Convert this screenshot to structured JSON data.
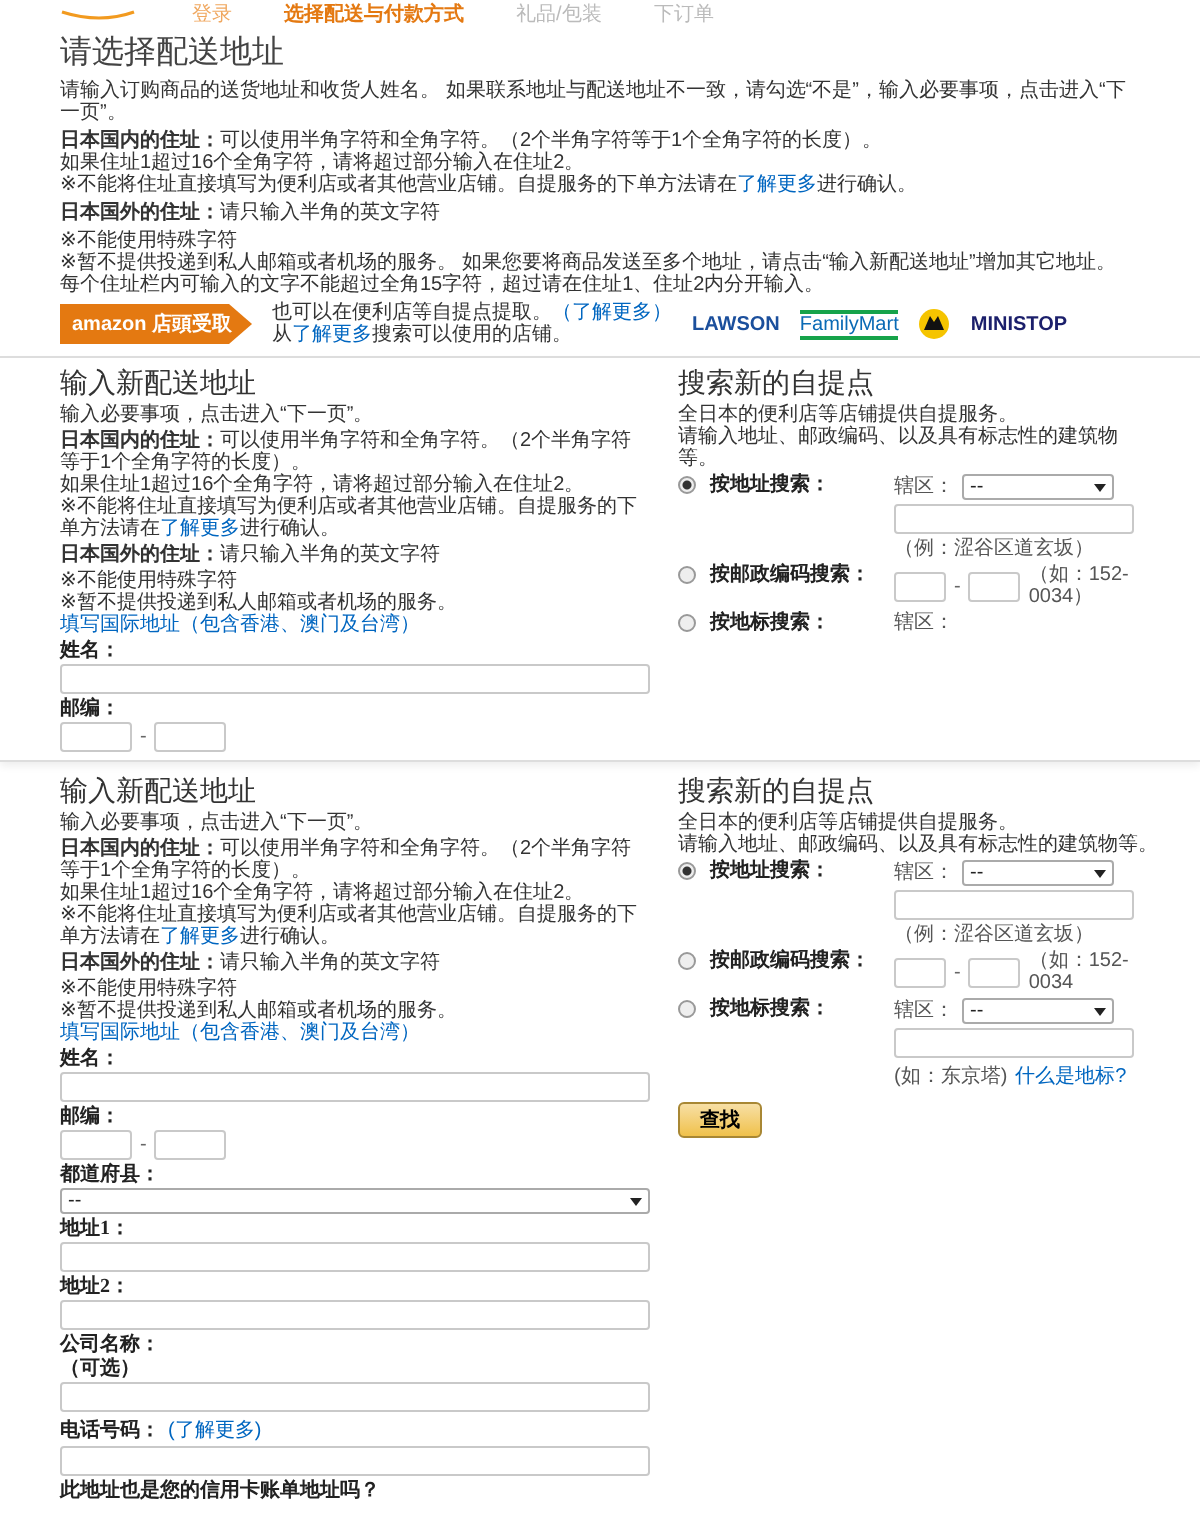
{
  "header": {
    "steps": [
      {
        "label": "登录",
        "selected": false,
        "completed": true
      },
      {
        "label": "选择配送与付款方式",
        "selected": true,
        "completed": false
      },
      {
        "label": "礼品/包装",
        "selected": false,
        "completed": false
      },
      {
        "label": "下订单",
        "selected": false,
        "completed": false
      }
    ]
  },
  "intro": {
    "title": "请选择配送地址",
    "blocks": [
      [
        [
          {
            "kind": "text",
            "text": "请输入订购商品的送货地址和收货人姓名。 如果联系地址与配送地址不一致，请勾选“不是”，输入必要事项，点击进入“下一页”。"
          }
        ]
      ],
      [
        [
          {
            "kind": "text",
            "text": "**日本国内的住址：**可以使用半角字符和全角字符。（2个半角字符等于1个全角字符的长度）。"
          }
        ],
        [
          {
            "kind": "text",
            "text": "如果住址1超过16个全角字符，请将超过部分输入在住址2。"
          }
        ],
        [
          {
            "kind": "text",
            "text": "※不能将住址直接填写为便利店或者其他营业店铺。自提服务的下单方法请在"
          },
          {
            "kind": "link",
            "text": "了解更多"
          },
          {
            "kind": "text",
            "text": "进行确认。"
          }
        ]
      ],
      [
        [
          {
            "kind": "text",
            "text": "**日本国外的住址：**请只输入半角的英文字符"
          }
        ]
      ],
      [
        [
          {
            "kind": "text",
            "text": "※不能使用特殊字符"
          }
        ],
        [
          {
            "kind": "text",
            "text": "※暂不提供投递到私人邮箱或者机场的服务。 如果您要将商品发送至多个地址，请点击“输入新配送地址”增加其它地址。"
          }
        ],
        [
          {
            "kind": "text",
            "text": "每个住址栏内可输入的文字不能超过全角15字符，超过请在住址1、住址2内分开输入。"
          }
        ]
      ]
    ],
    "pickup": {
      "badge": "amazon 店頭受取",
      "lines": [
        [
          {
            "kind": "text",
            "text": "也可以在便利店等自提点提取。"
          },
          {
            "kind": "link",
            "text": "（了解更多）"
          }
        ],
        [
          {
            "kind": "text",
            "text": "从"
          },
          {
            "kind": "link",
            "text": "了解更多"
          },
          {
            "kind": "text",
            "text": "搜索可以使用的店铺。"
          }
        ]
      ],
      "logos": [
        {
          "kind": "lawson",
          "text": "LAWSON"
        },
        {
          "kind": "familymart",
          "text": "FamilyMart"
        },
        {
          "kind": "yamato"
        },
        {
          "kind": "ministop",
          "text": "MINISTOP"
        }
      ]
    }
  },
  "sections": [
    {
      "form": {
        "title": "输入新配送地址",
        "blocks": [
          [
            [
              {
                "kind": "text",
                "text": "输入必要事项，点击进入“下一页”。"
              }
            ]
          ],
          [
            [
              {
                "kind": "text",
                "text": "**日本国内的住址：**可以使用半角字符和全角字符。（2个半角字符等于1个全角字符的长度）。"
              }
            ],
            [
              {
                "kind": "text",
                "text": "如果住址1超过16个全角字符，请将超过部分输入在住址2。"
              }
            ],
            [
              {
                "kind": "text",
                "text": "※不能将住址直接填写为便利店或者其他营业店铺。自提服务的下单方法请在"
              },
              {
                "kind": "link",
                "text": "了解更多"
              },
              {
                "kind": "text",
                "text": "进行确认。"
              }
            ]
          ],
          [
            [
              {
                "kind": "text",
                "text": "**日本国外的住址：**请只输入半角的英文字符"
              }
            ]
          ],
          [
            [
              {
                "kind": "text",
                "text": "※不能使用特殊字符"
              }
            ],
            [
              {
                "kind": "text",
                "text": "※暂不提供投递到私人邮箱或者机场的服务。"
              }
            ],
            [
              {
                "kind": "link",
                "text": "填写国际地址（包含香港、澳门及台湾）"
              }
            ]
          ]
        ],
        "fields": [
          {
            "kind": "text",
            "label": "姓名："
          },
          {
            "kind": "postal",
            "label": "邮编：",
            "separator": "-"
          }
        ]
      },
      "search": {
        "title": "搜索新的自提点",
        "lines": [
          "全日本的便利店等店铺提供自提服务。",
          "请输入地址、邮政编码、以及具有标志性的建筑物等。"
        ],
        "options": [
          {
            "kind": "address",
            "label": "按地址搜索：",
            "selected": true,
            "region_label": "辖区：",
            "region_value": "--",
            "example": "（例：涩谷区道玄坂）"
          },
          {
            "kind": "postal",
            "label": "按邮政编码搜索：",
            "selected": false,
            "separator": "-",
            "example": "（如：152-0034）"
          },
          {
            "kind": "landmark",
            "label": "按地标搜索：",
            "selected": false,
            "region_label": "辖区："
          }
        ]
      }
    },
    {
      "form": {
        "title": "输入新配送地址",
        "blocks": [
          [
            [
              {
                "kind": "text",
                "text": "输入必要事项，点击进入“下一页”。"
              }
            ]
          ],
          [
            [
              {
                "kind": "text",
                "text": "**日本国内的住址：**可以使用半角字符和全角字符。（2个半角字符等于1个全角字符的长度）。"
              }
            ],
            [
              {
                "kind": "text",
                "text": "如果住址1超过16个全角字符，请将超过部分输入在住址2。"
              }
            ],
            [
              {
                "kind": "text",
                "text": "※不能将住址直接填写为便利店或者其他营业店铺。自提服务的下单方法请在"
              },
              {
                "kind": "link",
                "text": "了解更多"
              },
              {
                "kind": "text",
                "text": "进行确认。"
              }
            ]
          ],
          [
            [
              {
                "kind": "text",
                "text": "**日本国外的住址：**请只输入半角的英文字符"
              }
            ]
          ],
          [
            [
              {
                "kind": "text",
                "text": "※不能使用特殊字符"
              }
            ],
            [
              {
                "kind": "text",
                "text": "※暂不提供投递到私人邮箱或者机场的服务。"
              }
            ],
            [
              {
                "kind": "link",
                "text": "填写国际地址（包含香港、澳门及台湾）"
              }
            ]
          ]
        ],
        "fields": [
          {
            "kind": "text",
            "label": "姓名："
          },
          {
            "kind": "postal",
            "label": "邮编：",
            "separator": "-"
          },
          {
            "kind": "select",
            "label": "都道府县：",
            "value": "--"
          },
          {
            "kind": "text",
            "label": "地址1："
          },
          {
            "kind": "text",
            "label": "地址2："
          },
          {
            "kind": "text",
            "label": "公司名称：",
            "note": "（可选）"
          },
          {
            "kind": "text",
            "label": "电话号码：",
            "link": "(了解更多)"
          },
          {
            "kind": "question",
            "label": "此地址也是您的信用卡账单地址吗？"
          }
        ]
      },
      "search": {
        "title": "搜索新的自提点",
        "lines": [
          "全日本的便利店等店铺提供自提服务。",
          "请输入地址、邮政编码、以及具有标志性的建筑物等。"
        ],
        "options": [
          {
            "kind": "address",
            "label": "按地址搜索：",
            "selected": true,
            "region_label": "辖区：",
            "region_value": "--",
            "example": "（例：涩谷区道玄坂）"
          },
          {
            "kind": "postal",
            "label": "按邮政编码搜索：",
            "selected": false,
            "separator": "-",
            "example": "（如：152-0034"
          },
          {
            "kind": "landmark",
            "label": "按地标搜索：",
            "selected": false,
            "region_label": "辖区：",
            "region_value": "--",
            "example": "(如：东京塔)",
            "link": "什么是地标?"
          }
        ],
        "button": "查找"
      }
    }
  ]
}
